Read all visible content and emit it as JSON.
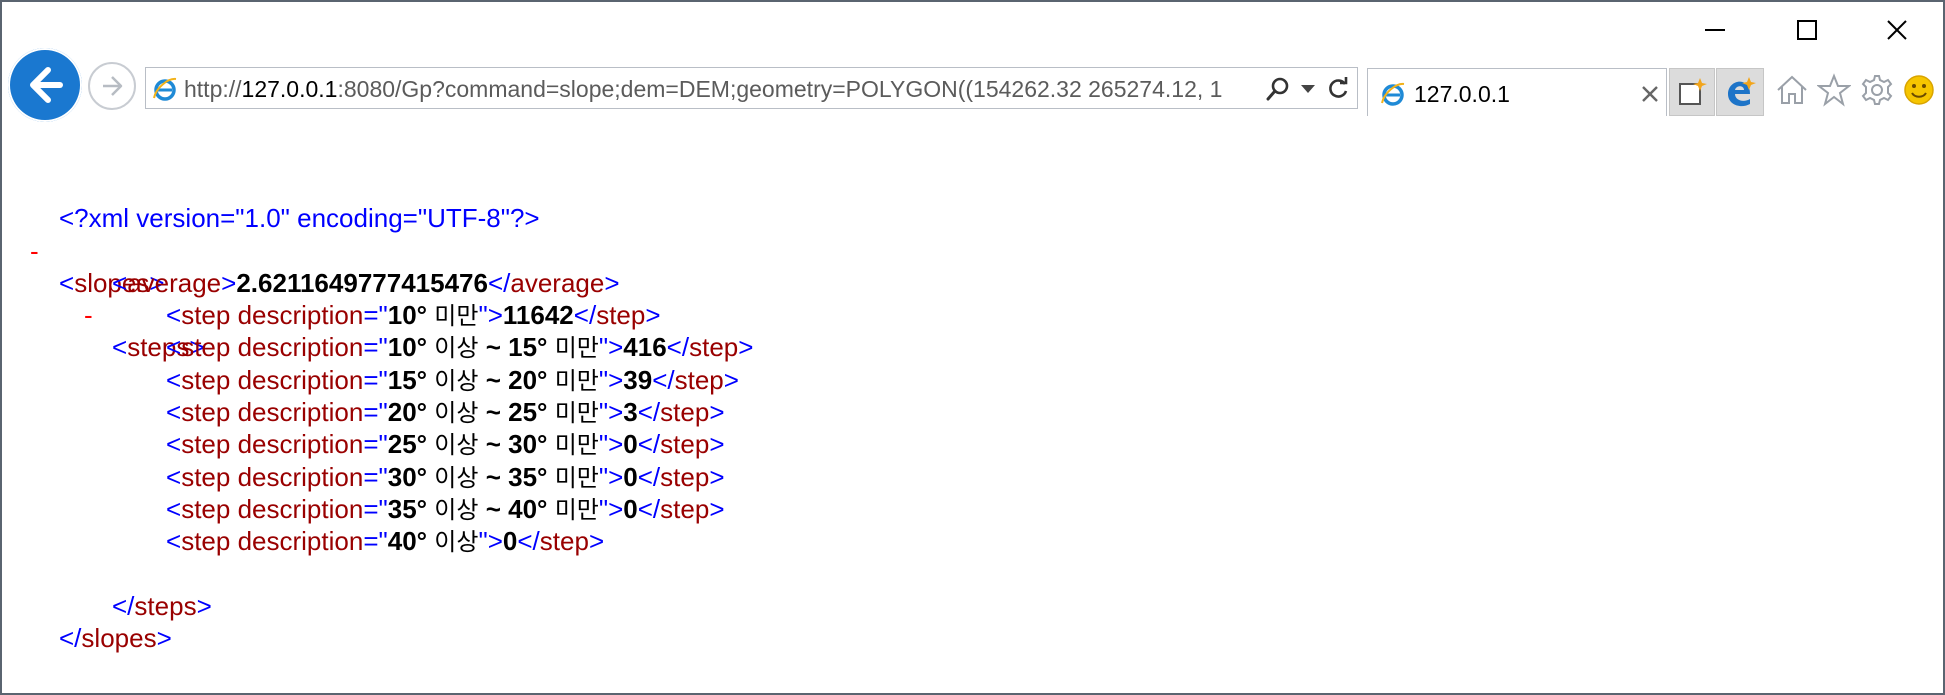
{
  "browser": {
    "url_prefix": "http://",
    "url_host": "127.0.0.1",
    "url_rest": ":8080/Gp?command=slope;dem=DEM;geometry=POLYGON((154262.32 265274.12, 1",
    "tab_title": "127.0.0.1",
    "tab_close": "×",
    "icons": {
      "back": "back-arrow-icon",
      "forward": "forward-arrow-icon",
      "ie": "internet-explorer-icon",
      "search": "search-icon",
      "dropdown": "chevron-down-icon",
      "refresh": "refresh-icon",
      "new_tab": "new-tab-icon",
      "edge": "edge-icon",
      "home": "home-icon",
      "favorites": "star-icon",
      "tools": "gear-icon",
      "feedback": "smiley-icon",
      "minimize": "minimize-icon",
      "maximize": "maximize-icon",
      "close": "close-icon"
    },
    "colors": {
      "back_button": "#1a78d0",
      "xml_markup": "#0000ff",
      "xml_name": "#990000",
      "collapse_dash": "#ff0000"
    }
  },
  "xml": {
    "declaration": "<?xml version=\"1.0\" encoding=\"UTF-8\"?>",
    "collapse": "-",
    "root_tag": "slopes",
    "average_tag": "average",
    "average_value": "2.6211649777415476",
    "steps_tag": "steps",
    "step_tag": "step",
    "attr_name": "description",
    "steps": [
      {
        "deg1": "10°",
        "kor1": "미만",
        "mid": "",
        "deg2": "",
        "kor2": "",
        "value": "11642"
      },
      {
        "deg1": "10°",
        "kor1": "이상",
        "mid": "~",
        "deg2": "15°",
        "kor2": "미만",
        "value": "416"
      },
      {
        "deg1": "15°",
        "kor1": "이상",
        "mid": "~",
        "deg2": "20°",
        "kor2": "미만",
        "value": "39"
      },
      {
        "deg1": "20°",
        "kor1": "이상",
        "mid": "~",
        "deg2": "25°",
        "kor2": "미만",
        "value": "3"
      },
      {
        "deg1": "25°",
        "kor1": "이상",
        "mid": "~",
        "deg2": "30°",
        "kor2": "미만",
        "value": "0"
      },
      {
        "deg1": "30°",
        "kor1": "이상",
        "mid": "~",
        "deg2": "35°",
        "kor2": "미만",
        "value": "0"
      },
      {
        "deg1": "35°",
        "kor1": "이상",
        "mid": "~",
        "deg2": "40°",
        "kor2": "미만",
        "value": "0"
      },
      {
        "deg1": "40°",
        "kor1": "이상",
        "mid": "",
        "deg2": "",
        "kor2": "",
        "value": "0"
      }
    ]
  }
}
